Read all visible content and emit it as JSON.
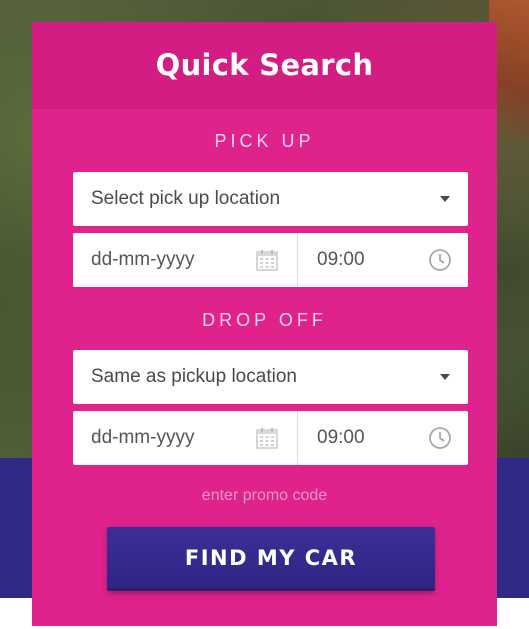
{
  "panel": {
    "title": "Quick Search",
    "pickup": {
      "label": "PICK UP",
      "location_placeholder": "Select pick up location",
      "date_placeholder": "dd-mm-yyyy",
      "time_value": "09:00"
    },
    "dropoff": {
      "label": "DROP OFF",
      "location_value": "Same as pickup location",
      "date_placeholder": "dd-mm-yyyy",
      "time_value": "09:00"
    },
    "promo_link": "enter promo code",
    "submit_label": "FIND MY CAR"
  },
  "colors": {
    "panel": "#e0228c",
    "header": "#d41d83",
    "button": "#2e2585",
    "band": "#2f2a83"
  },
  "icons": {
    "dropdown": "chevron-down-icon",
    "date": "calendar-icon",
    "time": "clock-icon"
  }
}
